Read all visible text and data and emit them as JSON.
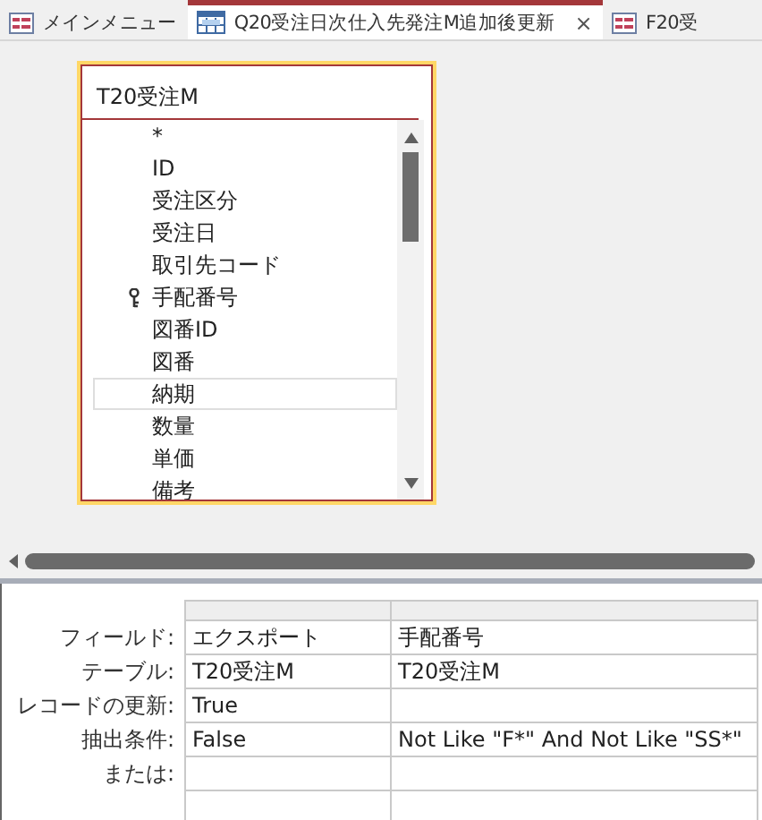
{
  "tabs": [
    {
      "label": "メインメニュー",
      "kind": "form",
      "selected": false
    },
    {
      "label": "Q20受注日次仕入先発注M追加後更新",
      "kind": "query",
      "selected": true,
      "close": "×"
    },
    {
      "label": "F20受",
      "kind": "form",
      "selected": false
    }
  ],
  "table": {
    "title": "T20受注M",
    "fields": [
      {
        "name": "*",
        "key": false,
        "selected": false
      },
      {
        "name": "ID",
        "key": false,
        "selected": false
      },
      {
        "name": "受注区分",
        "key": false,
        "selected": false
      },
      {
        "name": "受注日",
        "key": false,
        "selected": false
      },
      {
        "name": "取引先コード",
        "key": false,
        "selected": false
      },
      {
        "name": "手配番号",
        "key": true,
        "selected": false
      },
      {
        "name": "図番ID",
        "key": false,
        "selected": false
      },
      {
        "name": "図番",
        "key": false,
        "selected": false
      },
      {
        "name": "納期",
        "key": false,
        "selected": true
      },
      {
        "name": "数量",
        "key": false,
        "selected": false
      },
      {
        "name": "単価",
        "key": false,
        "selected": false
      },
      {
        "name": "備考",
        "key": false,
        "selected": false
      }
    ]
  },
  "grid": {
    "row_labels": [
      "フィールド:",
      "テーブル:",
      "レコードの更新:",
      "抽出条件:",
      "または:"
    ],
    "columns": [
      {
        "field": "エクスポート",
        "table": "T20受注M",
        "update": "True",
        "criteria": "False"
      },
      {
        "field": "手配番号",
        "table": "T20受注M",
        "criteria": "Not Like \"F*\" And Not Like \"SS*\""
      }
    ]
  }
}
